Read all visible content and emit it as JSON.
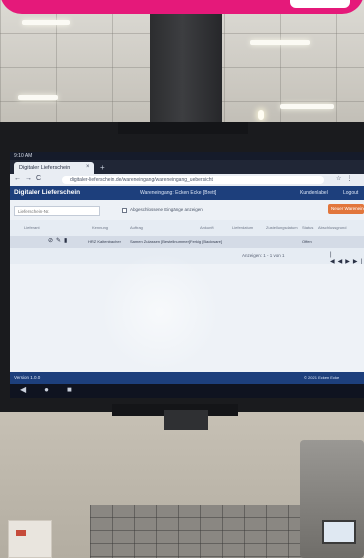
{
  "browser": {
    "clock": "9:10 AM",
    "tab_title": "Digitaler Lieferschein",
    "tab_close": "×",
    "new_tab": "+",
    "nav": "←→C",
    "url": "digitaler-lieferschein.de/wareneingang/wareneingang_uebersicht",
    "addr_icons": "☆⋮"
  },
  "app": {
    "title": "Digitaler Lieferschein",
    "location": "Wareneingang: Ecken Ecke [Brett]",
    "user": "Kundenlabel",
    "logout": "Logout",
    "search_placeholder": "Lieferschein-Nr.",
    "checkbox_label": "Abgeschlossene Eingänge anzeigen",
    "new_button": "Neuer Wareneingang",
    "columns": [
      "Lieferant",
      "Kennung",
      "Auftrag",
      "Ankunft",
      "Lieferdatum",
      "Zustellungsdatum",
      "Status",
      "Abschlussgrund"
    ],
    "row": {
      "actions": "⊘✎▮",
      "values": [
        "HRZ Kaltenbacher",
        "Samen Zulassen [Bestellnummer]",
        "Ferkig [Backware]",
        "Offen"
      ]
    },
    "pager": "Anzeigen: 1 - 1 von 1",
    "pager_nav": "|◀◀▶▶|",
    "status_left": "Version 1.0.0",
    "status_right": "© 2021 Ecken Ecke",
    "android_nav": "◀●■"
  },
  "colors": {
    "banner": "#e5197a",
    "header": "#1d3f7c",
    "button": "#e2763c"
  }
}
